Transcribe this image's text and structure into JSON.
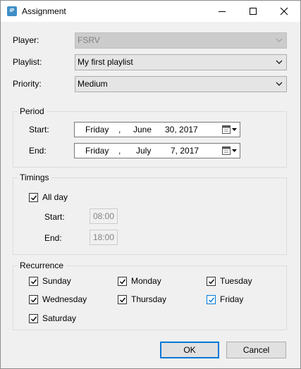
{
  "window": {
    "title": "Assignment",
    "icon_text": "IP"
  },
  "form": {
    "player": {
      "label": "Player:",
      "value": "FSRV",
      "enabled": false
    },
    "playlist": {
      "label": "Playlist:",
      "value": "My first playlist"
    },
    "priority": {
      "label": "Priority:",
      "value": "Medium"
    }
  },
  "period": {
    "title": "Period",
    "start": {
      "label": "Start:",
      "weekday": "Friday",
      "comma": ",",
      "month": "June",
      "day_year": "30, 2017"
    },
    "end": {
      "label": "End:",
      "weekday": "Friday",
      "comma": ",",
      "month": "July",
      "day_year": "7, 2017"
    }
  },
  "timings": {
    "title": "Timings",
    "all_day": {
      "label": "All day",
      "checked": true
    },
    "start": {
      "label": "Start:",
      "value": "08:00"
    },
    "end": {
      "label": "End:",
      "value": "18:00"
    }
  },
  "recurrence": {
    "title": "Recurrence",
    "days": {
      "sunday": {
        "label": "Sunday",
        "checked": true
      },
      "monday": {
        "label": "Monday",
        "checked": true
      },
      "tuesday": {
        "label": "Tuesday",
        "checked": true
      },
      "wednesday": {
        "label": "Wednesday",
        "checked": true
      },
      "thursday": {
        "label": "Thursday",
        "checked": true
      },
      "friday": {
        "label": "Friday",
        "checked": true
      },
      "saturday": {
        "label": "Saturday",
        "checked": true
      }
    }
  },
  "buttons": {
    "ok": "OK",
    "cancel": "Cancel"
  },
  "icons": {
    "app": "app-icon",
    "minimize": "minimize-icon",
    "maximize": "maximize-icon",
    "close": "close-icon",
    "dropdown": "chevron-down-icon",
    "calendar": "calendar-icon",
    "check": "checkmark-icon"
  },
  "colors": {
    "accent": "#0078d7",
    "app_icon": "#3f8fc6",
    "window_bg": "#f0f0f0"
  }
}
